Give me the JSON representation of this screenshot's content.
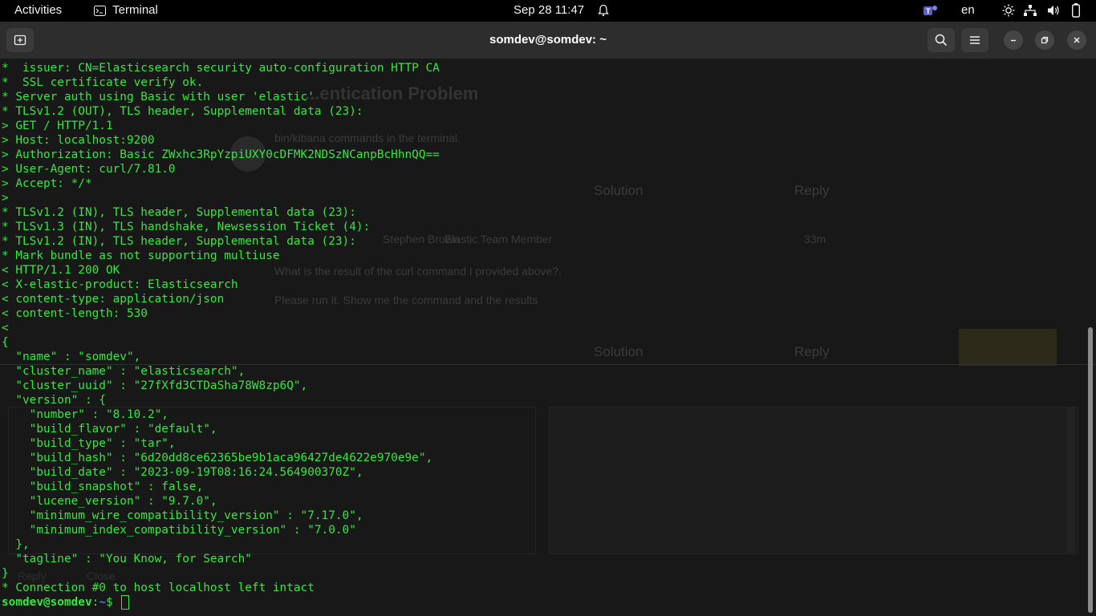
{
  "topbar": {
    "activities": "Activities",
    "app_name": "Terminal",
    "clock": "Sep 28  11:47",
    "lang": "en"
  },
  "window": {
    "title": "somdev@somdev: ~"
  },
  "terminal": {
    "lines": [
      "*  issuer: CN=Elasticsearch security auto-configuration HTTP CA",
      "*  SSL certificate verify ok.",
      "* Server auth using Basic with user 'elastic'",
      "* TLSv1.2 (OUT), TLS header, Supplemental data (23):",
      "> GET / HTTP/1.1",
      "> Host: localhost:9200",
      "> Authorization: Basic ZWxhc3RpYzpiUXY0cDFMK2NDSzNCanpBcHhnQQ==",
      "> User-Agent: curl/7.81.0",
      "> Accept: */*",
      ">",
      "* TLSv1.2 (IN), TLS header, Supplemental data (23):",
      "* TLSv1.3 (IN), TLS handshake, Newsession Ticket (4):",
      "* TLSv1.2 (IN), TLS header, Supplemental data (23):",
      "* Mark bundle as not supporting multiuse",
      "< HTTP/1.1 200 OK",
      "< X-elastic-product: Elasticsearch",
      "< content-type: application/json",
      "< content-length: 530",
      "<",
      "{",
      "  \"name\" : \"somdev\",",
      "  \"cluster_name\" : \"elasticsearch\",",
      "  \"cluster_uuid\" : \"27fXfd3CTDaSha78W8zp6Q\",",
      "  \"version\" : {",
      "    \"number\" : \"8.10.2\",",
      "    \"build_flavor\" : \"default\",",
      "    \"build_type\" : \"tar\",",
      "    \"build_hash\" : \"6d20dd8ce62365be9b1aca96427de4622e970e9e\",",
      "    \"build_date\" : \"2023-09-19T08:16:24.564900370Z\",",
      "    \"build_snapshot\" : false,",
      "    \"lucene_version\" : \"9.7.0\",",
      "    \"minimum_wire_compatibility_version\" : \"7.17.0\",",
      "    \"minimum_index_compatibility_version\" : \"7.0.0\"",
      "  },",
      "  \"tagline\" : \"You Know, for Search\"",
      "}",
      "* Connection #0 to host localhost left intact"
    ],
    "prompt_user": "somdev@somdev",
    "prompt_sep": ":",
    "prompt_path": "~",
    "prompt_symbol": "$ "
  },
  "background_page": {
    "title": "...entication Problem",
    "line1": "bin/kibana commands in the terminal.",
    "solution1": "Solution",
    "reply1": "Reply",
    "author": "Stephen Brown",
    "role": "Elastic Team Member",
    "time": "33m",
    "message1": "What is the result of the curl command I provided above?.",
    "message2": "Please run it. Show me the command and the results",
    "solution2": "Solution",
    "reply2": "Reply",
    "reply_btn": "Reply",
    "close_btn": "Close"
  },
  "colors": {
    "terminal_bg": "#181818",
    "terminal_text": "#33e83f",
    "prompt_path": "#4a7ee0",
    "header_bg": "#2d2d2d",
    "topbar_bg": "#000000"
  }
}
